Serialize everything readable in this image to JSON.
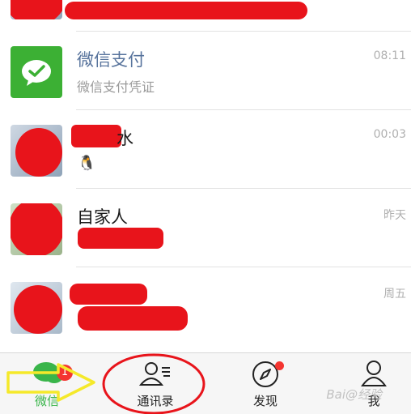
{
  "chats": [
    {
      "name": "",
      "preview": "",
      "time": ""
    },
    {
      "name": "微信支付",
      "preview": "微信支付凭证",
      "time": "08:11"
    },
    {
      "name": "水",
      "preview": "",
      "time": "00:03"
    },
    {
      "name": "自家人",
      "preview": "",
      "time": "昨天"
    },
    {
      "name": "",
      "preview": "",
      "time": "周五"
    }
  ],
  "tabs": {
    "chats": {
      "label": "微信",
      "badge": "1",
      "icon": "chat-bubbles-icon"
    },
    "contacts": {
      "label": "通讯录",
      "icon": "contacts-icon"
    },
    "discover": {
      "label": "发现",
      "icon": "compass-icon"
    },
    "me": {
      "label": "我",
      "icon": "person-icon"
    }
  },
  "watermark": "Bai@经验",
  "colors": {
    "accent": "#39b54a",
    "badge": "#f43530",
    "wechat_pay": "#3cb034",
    "annotation": "#e8141b",
    "arrow": "#f5e92a"
  }
}
